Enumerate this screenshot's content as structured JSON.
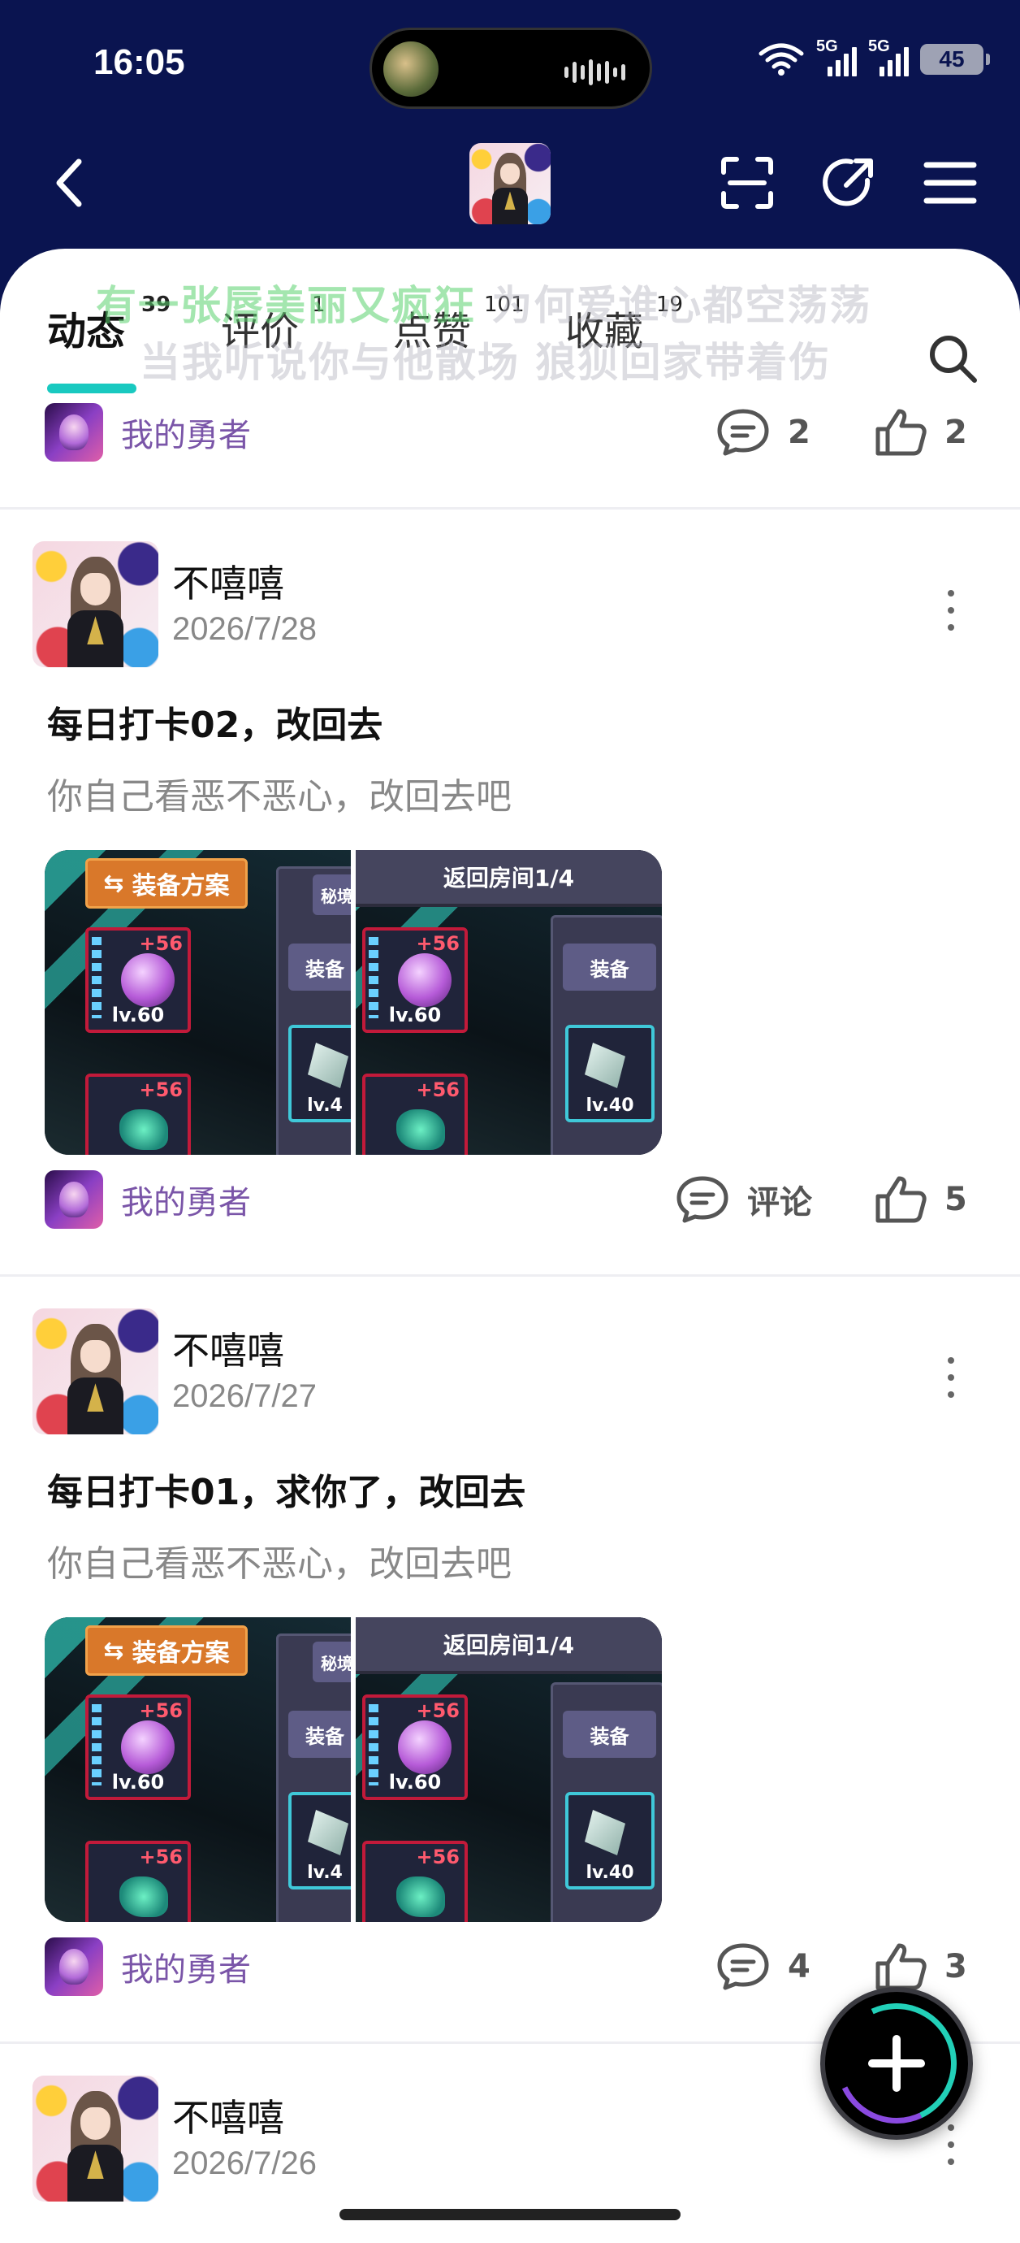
{
  "status_bar": {
    "time": "16:05",
    "network_1": "5G",
    "network_2": "5G",
    "battery": "45"
  },
  "nav": {
    "icons": [
      "back-icon",
      "scan-icon",
      "share-icon",
      "menu-icon"
    ]
  },
  "tabs": [
    {
      "label": "动态",
      "count": "39"
    },
    {
      "label": "评价",
      "count": "1"
    },
    {
      "label": "点赞",
      "count": "101"
    },
    {
      "label": "收藏",
      "count": "19"
    }
  ],
  "lyrics": {
    "line1_highlight": "有一张唇美丽又疯狂",
    "line1_rest": " 为何爱谁心都空荡荡",
    "line2": "当我听说你与他散场 狼狈回家带着伤"
  },
  "top_footer": {
    "guild": "我的勇者",
    "comments": "2",
    "likes": "2"
  },
  "posts": [
    {
      "author": "不嘻嘻",
      "date": "2026/7/28",
      "title": "每日打卡02，改回去",
      "body": "你自己看恶不恶心，改回去吧",
      "images": {
        "left_button": "装备方案",
        "right_banner": "返回房间1/4",
        "side_label_1": "秘境",
        "side_label_2": "装备",
        "level_a": "lv.60",
        "level_b": "lv.40",
        "level_c": "lv.4",
        "plus": "+56"
      },
      "guild": "我的勇者",
      "comments": "评论",
      "likes": "5"
    },
    {
      "author": "不嘻嘻",
      "date": "2026/7/27",
      "title": "每日打卡01，求你了，改回去",
      "body": "你自己看恶不恶心，改回去吧",
      "images": {
        "left_button": "装备方案",
        "right_banner": "返回房间1/4",
        "side_label_1": "秘境",
        "side_label_2": "装备",
        "level_a": "lv.60",
        "level_b": "lv.40",
        "level_c": "lv.4",
        "plus": "+56"
      },
      "guild": "我的勇者",
      "comments": "4",
      "likes": "3"
    },
    {
      "author": "不嘻嘻",
      "date": "2026/7/26"
    }
  ],
  "colors": {
    "header_bg": "#0a1450",
    "tab_accent": "#19c9c0",
    "guild_text": "#7a55a8"
  }
}
